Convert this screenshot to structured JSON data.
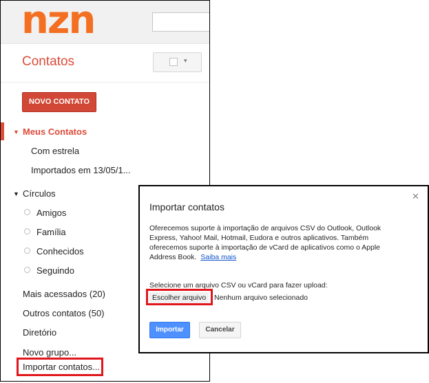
{
  "header": {
    "logo_text": "nzn",
    "logo_color": "#f36f21"
  },
  "app": {
    "title": "Contatos",
    "accent_color": "#dd4b39"
  },
  "toolbar": {
    "select_arrow": "▾"
  },
  "new_contact_button": "NOVO CONTATO",
  "sidebar": {
    "my_contacts": {
      "label": "Meus Contatos",
      "expand_icon": "▼"
    },
    "my_contacts_items": [
      "Com estrela",
      "Importados em 13/05/1..."
    ],
    "circles": {
      "label": "Círculos",
      "expand_icon": "▼"
    },
    "circles_items": [
      "Amigos",
      "Família",
      "Conhecidos",
      "Seguindo"
    ],
    "other_items": [
      "Mais acessados (20)",
      "Outros contatos (50)",
      "Diretório",
      "Novo grupo...",
      "Importar contatos..."
    ]
  },
  "dialog": {
    "title": "Importar contatos",
    "close_icon": "✕",
    "description": "Oferecemos suporte à importação de arquivos CSV do Outlook, Outlook Express, Yahoo! Mail, Hotmail, Eudora e outros aplicativos. Também oferecemos suporte à importação de vCard de aplicativos como o Apple Address Book.",
    "link": "Saiba mais",
    "upload_label": "Selecione um arquivo CSV ou vCard para fazer upload:",
    "choose_file_button": "Escolher arquivo",
    "file_status": "Nenhum arquivo selecionado",
    "import_button": "Importar",
    "cancel_button": "Cancelar"
  },
  "highlight_color": "#e1151c"
}
